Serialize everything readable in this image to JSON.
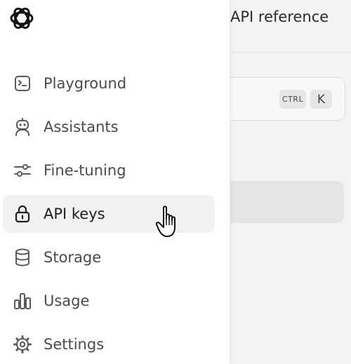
{
  "header": {
    "top_link": "API reference"
  },
  "search": {
    "shortcut_modifier": "CTRL",
    "shortcut_key": "K"
  },
  "sidebar": {
    "items": [
      {
        "label": "Playground",
        "icon": "terminal-icon",
        "active": false
      },
      {
        "label": "Assistants",
        "icon": "robot-icon",
        "active": false
      },
      {
        "label": "Fine-tuning",
        "icon": "sliders-icon",
        "active": false
      },
      {
        "label": "API keys",
        "icon": "lock-icon",
        "active": true
      },
      {
        "label": "Storage",
        "icon": "database-icon",
        "active": false
      },
      {
        "label": "Usage",
        "icon": "bar-chart-icon",
        "active": false
      },
      {
        "label": "Settings",
        "icon": "gear-icon",
        "active": false
      }
    ]
  },
  "colors": {
    "sidebar_bg": "#ffffff",
    "overlay_bg": "#f3f3f3",
    "active_item_bg": "#f2f2f2",
    "label_text": "#4a4a4a"
  }
}
